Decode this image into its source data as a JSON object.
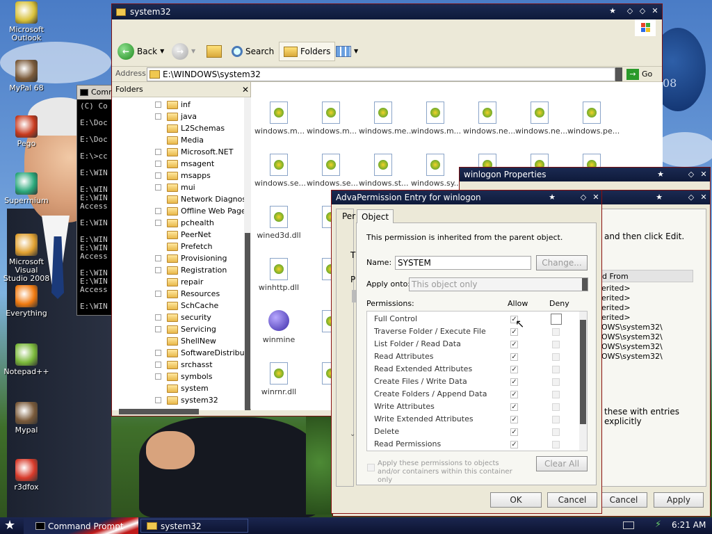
{
  "desktop": {
    "icons": [
      {
        "label": "Microsoft Outlook",
        "icon": "outlook-icon",
        "color": "#d8c13a"
      },
      {
        "label": "MyPal 68",
        "icon": "mypal-icon",
        "color": "#7a5a3a"
      },
      {
        "label": "Pego",
        "icon": "pego-icon",
        "color": "#c83a1e"
      },
      {
        "label": "Supermium",
        "icon": "supermium-icon",
        "color": "#2aa87a"
      },
      {
        "label": "Microsoft Visual Studio 2008",
        "icon": "visual-studio-icon",
        "color": "#e0a030"
      },
      {
        "label": "Everything",
        "icon": "everything-icon",
        "color": "#f07a10"
      },
      {
        "label": "Notepad++",
        "icon": "notepadpp-icon",
        "color": "#7ab83a"
      },
      {
        "label": "Mypal",
        "icon": "mypal-icon",
        "color": "#7a5a3a"
      },
      {
        "label": "r3dfox",
        "icon": "r3dfox-icon",
        "color": "#d83a2a"
      }
    ],
    "wallpaper_text": "08"
  },
  "cmd": {
    "title": "Comm",
    "lines": "(C) Co\n\nE:\\Doc\n\nE:\\Doc\n\nE:\\>cc\n\nE:\\WIN\n\nE:\\WIN\nE:\\WIN\nAccess\n\nE:\\WIN\n\nE:\\WIN\nE:\\WIN\nAccess\n\nE:\\WIN\nE:\\WIN\nAccess\n\nE:\\WIN"
  },
  "explorer": {
    "title": "system32",
    "toolbar": {
      "back": "Back",
      "search": "Search",
      "folders": "Folders"
    },
    "address_label": "Address",
    "address": "E:\\WINDOWS\\system32",
    "go": "Go",
    "folders_header": "Folders",
    "tree": [
      {
        "name": "inf",
        "box": true
      },
      {
        "name": "java",
        "box": true
      },
      {
        "name": "L2Schemas",
        "box": false
      },
      {
        "name": "Media",
        "box": false
      },
      {
        "name": "Microsoft.NET",
        "box": true
      },
      {
        "name": "msagent",
        "box": true
      },
      {
        "name": "msapps",
        "box": true
      },
      {
        "name": "mui",
        "box": true
      },
      {
        "name": "Network Diagnostic",
        "box": false
      },
      {
        "name": "Offline Web Pages",
        "box": true
      },
      {
        "name": "pchealth",
        "box": true
      },
      {
        "name": "PeerNet",
        "box": false
      },
      {
        "name": "Prefetch",
        "box": false
      },
      {
        "name": "Provisioning",
        "box": true
      },
      {
        "name": "Registration",
        "box": true
      },
      {
        "name": "repair",
        "box": false
      },
      {
        "name": "Resources",
        "box": true
      },
      {
        "name": "SchCache",
        "box": false
      },
      {
        "name": "security",
        "box": true
      },
      {
        "name": "Servicing",
        "box": true
      },
      {
        "name": "ShellNew",
        "box": false
      },
      {
        "name": "SoftwareDistributio",
        "box": true
      },
      {
        "name": "srchasst",
        "box": true
      },
      {
        "name": "symbols",
        "box": true
      },
      {
        "name": "system",
        "box": false
      },
      {
        "name": "system32",
        "box": true
      }
    ],
    "files": [
      "windows.m...",
      "windows.m...",
      "windows.me...",
      "windows.m...",
      "windows.ne...",
      "windows.ne...",
      "windows.pe...",
      "windows.se...",
      "windows.se...",
      "windows.st...",
      "windows.sy...",
      "wined3d.dll",
      "winhttp.dll",
      "winmine",
      "winrnr.dll"
    ]
  },
  "winlogon_props": {
    "title": "winlogon Properties",
    "text_edit": "and then click Edit.",
    "inherited_header": "d From",
    "inherited_rows": [
      "erited>",
      "erited>",
      "erited>",
      "erited>",
      "OWS\\system32\\",
      "OWS\\system32\\",
      "OWS\\system32\\",
      "OWS\\system32\\"
    ],
    "footer_text": "these with entries explicitly",
    "cancel": "Cancel",
    "apply": "Apply"
  },
  "advanced": {
    "title": "Adva",
    "tab": "Per",
    "t1": "T",
    "t2": "P"
  },
  "perm_entry": {
    "title": "Permission Entry for winlogon",
    "tab": "Object",
    "inherited_note": "This permission is inherited from the parent object.",
    "name_label": "Name:",
    "name_value": "SYSTEM",
    "change": "Change...",
    "apply_label": "Apply onto:",
    "apply_value": "This object only",
    "permissions_label": "Permissions:",
    "allow": "Allow",
    "deny": "Deny",
    "rows": [
      {
        "name": "Full Control",
        "allow": true
      },
      {
        "name": "Traverse Folder / Execute File",
        "allow": true
      },
      {
        "name": "List Folder / Read Data",
        "allow": true
      },
      {
        "name": "Read Attributes",
        "allow": true
      },
      {
        "name": "Read Extended Attributes",
        "allow": true
      },
      {
        "name": "Create Files / Write Data",
        "allow": true
      },
      {
        "name": "Create Folders / Append Data",
        "allow": true
      },
      {
        "name": "Write Attributes",
        "allow": true
      },
      {
        "name": "Write Extended Attributes",
        "allow": true
      },
      {
        "name": "Delete",
        "allow": true
      },
      {
        "name": "Read Permissions",
        "allow": true
      }
    ],
    "apply_check": "Apply these permissions to objects and/or containers within this container only",
    "clear_all": "Clear All",
    "ok": "OK",
    "cancel": "Cancel"
  },
  "taskbar": {
    "tasks": [
      "Command Prompt",
      "system32"
    ],
    "clock": "6:21 AM"
  }
}
